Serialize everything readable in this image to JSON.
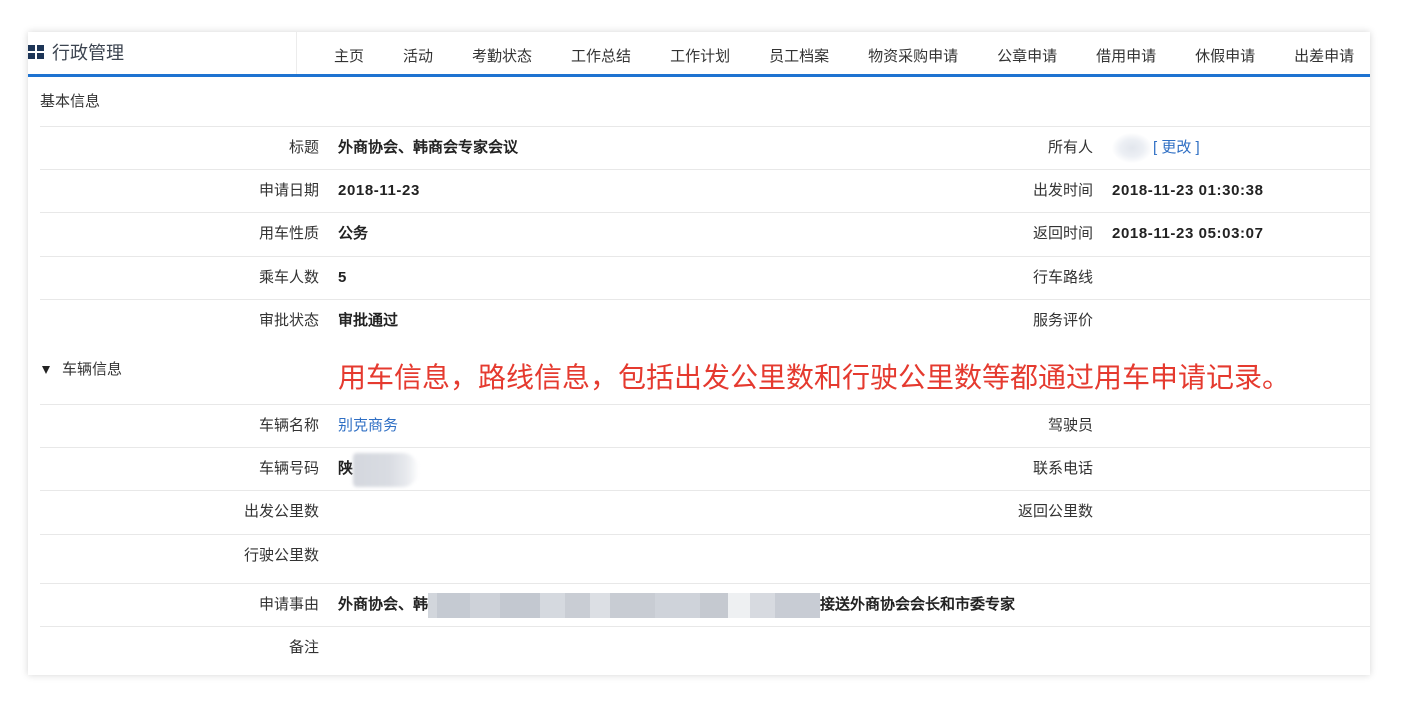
{
  "colors": {
    "accent": "#1e73d1",
    "link": "#2f6fc4",
    "annotation": "#e53a2f",
    "app_icon": "#1d3557"
  },
  "icons": {
    "app": "grid-icon",
    "section_toggle": "triangle-down-icon"
  },
  "header": {
    "title": "行政管理",
    "nav": [
      "主页",
      "活动",
      "考勤状态",
      "工作总结",
      "工作计划",
      "员工档案",
      "物资采购申请",
      "公章申请",
      "借用申请",
      "休假申请",
      "出差申请"
    ]
  },
  "basic_info": {
    "title": "基本信息",
    "rows": [
      {
        "label": "标题",
        "value": "外商协会、韩商会专家会议",
        "right_label": "所有人",
        "right_action": "[ 更改 ]"
      },
      {
        "label": "申请日期",
        "value": "2018-11-23",
        "right_label": "出发时间",
        "right_value": "2018-11-23 01:30:38"
      },
      {
        "label": "用车性质",
        "value": "公务",
        "right_label": "返回时间",
        "right_value": "2018-11-23 05:03:07"
      },
      {
        "label": "乘车人数",
        "value": "5",
        "right_label": "行车路线"
      },
      {
        "label": "审批状态",
        "value": "审批通过",
        "right_label": "服务评价"
      }
    ]
  },
  "vehicle_info": {
    "title": "车辆信息",
    "annotation": "用车信息，路线信息，包括出发公里数和行驶公里数等都通过用车申请记录。",
    "rows": [
      {
        "label": "车辆名称",
        "value": "别克商务",
        "right_label": "驾驶员"
      },
      {
        "label": "车辆号码",
        "value": "陕",
        "right_label": "联系电话"
      },
      {
        "label": "出发公里数",
        "right_label": "返回公里数"
      },
      {
        "label": "行驶公里数"
      },
      {
        "label": "申请事由",
        "value_start": "外商协会、韩",
        "value_end": "接送外商协会会长和市委专家"
      },
      {
        "label": "备注"
      }
    ]
  }
}
